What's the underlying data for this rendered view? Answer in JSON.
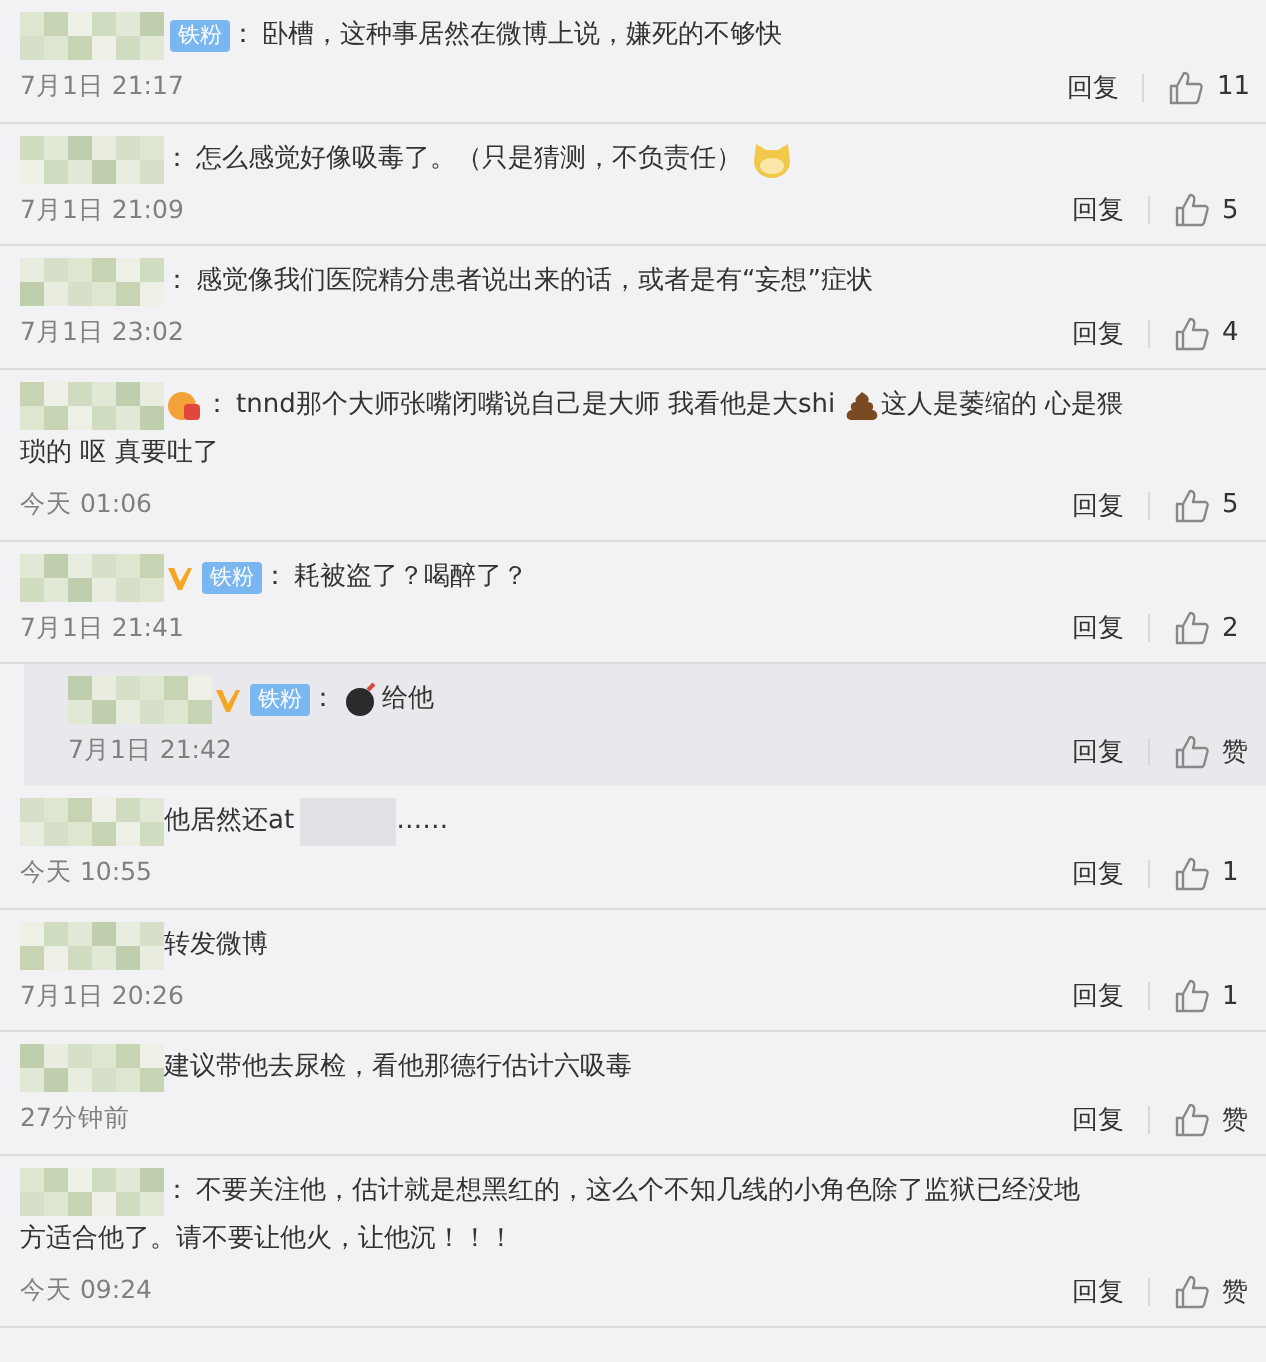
{
  "comments": [
    {
      "verified": false,
      "fan_badge": "铁粉",
      "separator": "：",
      "content": [
        {
          "kind": "text",
          "text": "卧槽，这种事居然在微博上说，嫌死的不够快"
        }
      ],
      "time": "7月1日 21:17",
      "reply": "回复",
      "likes": "11"
    },
    {
      "verified": false,
      "separator": "：",
      "content": [
        {
          "kind": "text",
          "text": "怎么感觉好像吸毒了。（只是猜测，不负责任）"
        },
        {
          "kind": "dog"
        }
      ],
      "time": "7月1日 21:09",
      "reply": "回复",
      "likes": "5"
    },
    {
      "verified": false,
      "separator": "：",
      "content": [
        {
          "kind": "text",
          "text": "感觉像我们医院精分患者说出来的话，或者是有“妄想”症状"
        }
      ],
      "time": "7月1日 23:02",
      "reply": "回复",
      "likes": "4"
    },
    {
      "verified": false,
      "medal": true,
      "separator": "：",
      "content": [
        {
          "kind": "text",
          "text": "tnnd那个大师张嘴闭嘴说自己是大师 我看他是大shi"
        },
        {
          "kind": "poop"
        },
        {
          "kind": "text",
          "text": "这人是萎缩的 心是猥"
        },
        {
          "kind": "break"
        },
        {
          "kind": "text",
          "text": "琐的 呕 真要吐了"
        }
      ],
      "time": "今天 01:06",
      "reply": "回复",
      "likes": "5"
    },
    {
      "verified": true,
      "fan_badge": "铁粉",
      "separator": "：",
      "content": [
        {
          "kind": "text",
          "text": "耗被盗了？喝醉了？"
        }
      ],
      "time": "7月1日 21:41",
      "reply": "回复",
      "likes": "2",
      "replies": [
        {
          "verified": true,
          "fan_badge": "铁粉",
          "separator": "：",
          "content": [
            {
              "kind": "bomb"
            },
            {
              "kind": "text",
              "text": "给他"
            }
          ],
          "time": "7月1日 21:42",
          "reply": "回复",
          "likes": "赞"
        }
      ]
    },
    {
      "verified": false,
      "content": [
        {
          "kind": "text",
          "text": "他居然还at"
        },
        {
          "kind": "blur"
        },
        {
          "kind": "text",
          "text": "……"
        }
      ],
      "time": "今天 10:55",
      "reply": "回复",
      "likes": "1"
    },
    {
      "verified": false,
      "content": [
        {
          "kind": "text",
          "text": "转发微博"
        }
      ],
      "time": "7月1日 20:26",
      "reply": "回复",
      "likes": "1"
    },
    {
      "verified": false,
      "content": [
        {
          "kind": "text",
          "text": "建议带他去尿检，看他那德行估计六吸毒"
        }
      ],
      "time": "27分钟前",
      "reply": "回复",
      "likes": "赞"
    },
    {
      "verified": false,
      "separator": "：",
      "content": [
        {
          "kind": "text",
          "text": "不要关注他，估计就是想黑红的，这么个不知几线的小角色除了监狱已经没地"
        },
        {
          "kind": "break"
        },
        {
          "kind": "text",
          "text": "方适合他了。请不要让他火，让他沉！！！"
        }
      ],
      "time": "今天 09:24",
      "reply": "回复",
      "likes": "赞"
    }
  ]
}
